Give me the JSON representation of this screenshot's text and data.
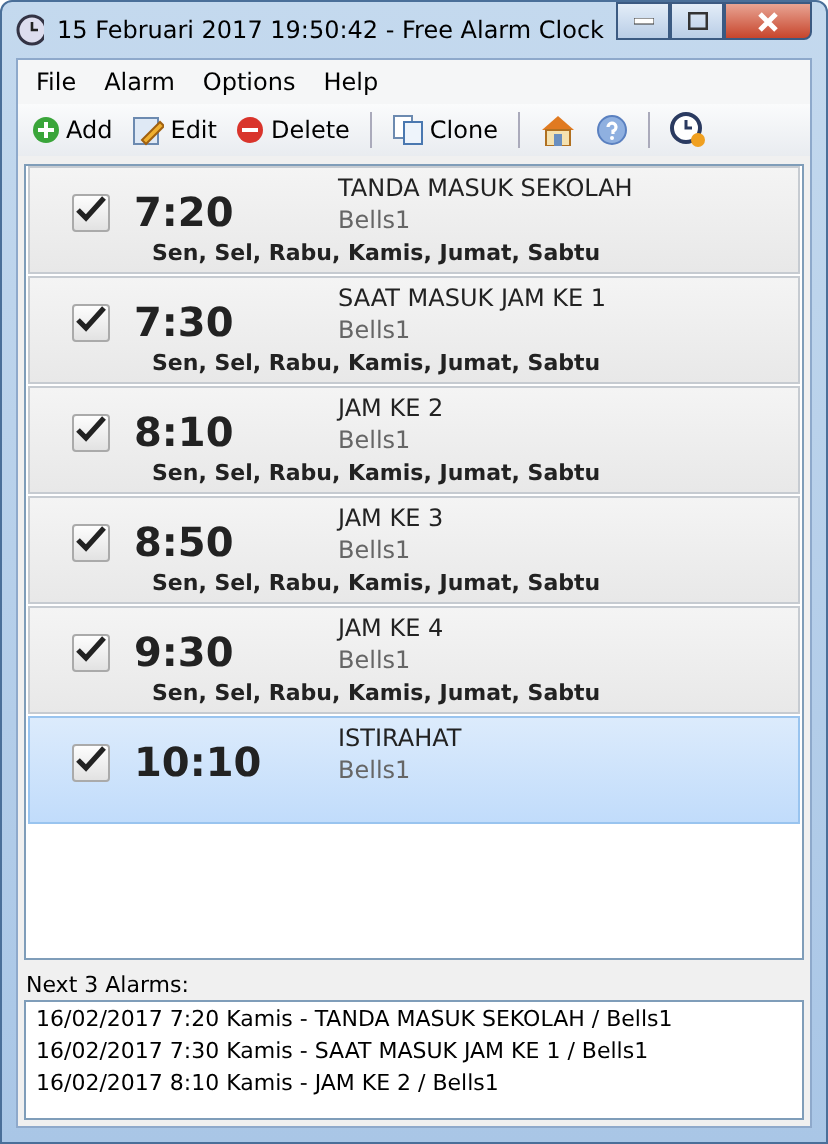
{
  "window": {
    "title": "15 Februari 2017 19:50:42 - Free Alarm Clock"
  },
  "menu": [
    "File",
    "Alarm",
    "Options",
    "Help"
  ],
  "toolbar": [
    {
      "kind": "add",
      "label": "Add"
    },
    {
      "kind": "edit",
      "label": "Edit"
    },
    {
      "kind": "delete",
      "label": "Delete"
    },
    {
      "kind": "sep"
    },
    {
      "kind": "clone",
      "label": "Clone"
    },
    {
      "kind": "sep"
    },
    {
      "kind": "home"
    },
    {
      "kind": "help"
    },
    {
      "kind": "sep"
    },
    {
      "kind": "clock"
    }
  ],
  "alarms": [
    {
      "checked": true,
      "selected": false,
      "time": "7:20",
      "label": "TANDA MASUK SEKOLAH",
      "sound": "Bells1",
      "days": "Sen, Sel, Rabu, Kamis, Jumat, Sabtu"
    },
    {
      "checked": true,
      "selected": false,
      "time": "7:30",
      "label": "SAAT MASUK JAM KE 1",
      "sound": "Bells1",
      "days": "Sen, Sel, Rabu, Kamis, Jumat, Sabtu"
    },
    {
      "checked": true,
      "selected": false,
      "time": "8:10",
      "label": "JAM KE 2",
      "sound": "Bells1",
      "days": "Sen, Sel, Rabu, Kamis, Jumat, Sabtu"
    },
    {
      "checked": true,
      "selected": false,
      "time": "8:50",
      "label": "JAM KE 3",
      "sound": "Bells1",
      "days": "Sen, Sel, Rabu, Kamis, Jumat, Sabtu"
    },
    {
      "checked": true,
      "selected": false,
      "time": "9:30",
      "label": "JAM KE 4",
      "sound": "Bells1",
      "days": "Sen, Sel, Rabu, Kamis, Jumat, Sabtu"
    },
    {
      "checked": true,
      "selected": true,
      "time": "10:10",
      "label": "ISTIRAHAT",
      "sound": "Bells1"
    }
  ],
  "next": {
    "title": "Next 3 Alarms:",
    "items": [
      "16/02/2017 7:20 Kamis - TANDA MASUK SEKOLAH / Bells1",
      "16/02/2017 7:30 Kamis - SAAT MASUK JAM KE 1 / Bells1",
      "16/02/2017 8:10 Kamis - JAM KE 2 / Bells1"
    ]
  }
}
